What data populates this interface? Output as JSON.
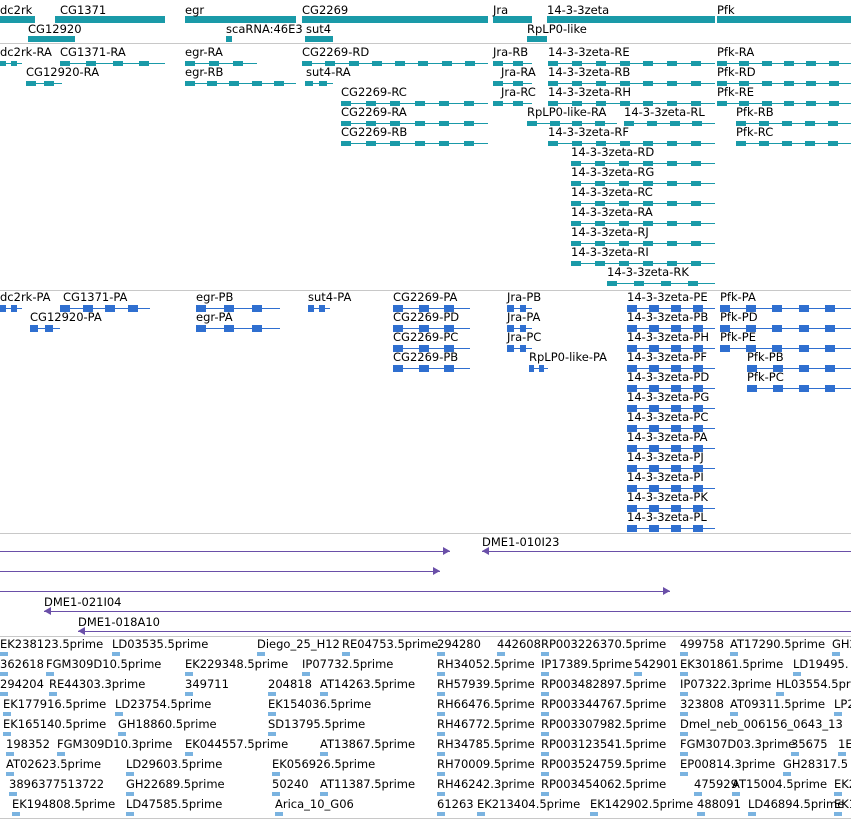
{
  "colors": {
    "gene": "#1a9aa8",
    "transcript": "#1a9aa8",
    "protein": "#2f6fd0",
    "clone": "#6a4fa8",
    "est": "#7ab3e0",
    "separator": "#c8c8c8"
  },
  "genes": [
    {
      "label": "dc2rk"
    },
    {
      "label": "CG1371"
    },
    {
      "label": "CG12920"
    },
    {
      "label": "egr"
    },
    {
      "label": "scaRNA:46E3"
    },
    {
      "label": "CG2269"
    },
    {
      "label": "sut4"
    },
    {
      "label": "Jra"
    },
    {
      "label": "14-3-3zeta"
    },
    {
      "label": "RpLP0-like"
    },
    {
      "label": "Pfk"
    }
  ],
  "transcripts": [
    {
      "label": "dc2rk-RA"
    },
    {
      "label": "CG1371-RA"
    },
    {
      "label": "CG12920-RA"
    },
    {
      "label": "egr-RA"
    },
    {
      "label": "egr-RB"
    },
    {
      "label": "CG2269-RD"
    },
    {
      "label": "sut4-RA"
    },
    {
      "label": "CG2269-RC"
    },
    {
      "label": "CG2269-RA"
    },
    {
      "label": "CG2269-RB"
    },
    {
      "label": "Jra-RB"
    },
    {
      "label": "Jra-RA"
    },
    {
      "label": "Jra-RC"
    },
    {
      "label": "RpLP0-like-RA"
    },
    {
      "label": "14-3-3zeta-RE"
    },
    {
      "label": "14-3-3zeta-RB"
    },
    {
      "label": "14-3-3zeta-RH"
    },
    {
      "label": "14-3-3zeta-RL"
    },
    {
      "label": "14-3-3zeta-RF"
    },
    {
      "label": "14-3-3zeta-RD"
    },
    {
      "label": "14-3-3zeta-RG"
    },
    {
      "label": "14-3-3zeta-RC"
    },
    {
      "label": "14-3-3zeta-RA"
    },
    {
      "label": "14-3-3zeta-RJ"
    },
    {
      "label": "14-3-3zeta-RI"
    },
    {
      "label": "14-3-3zeta-RK"
    },
    {
      "label": "Pfk-RA"
    },
    {
      "label": "Pfk-RD"
    },
    {
      "label": "Pfk-RE"
    },
    {
      "label": "Pfk-RB"
    },
    {
      "label": "Pfk-RC"
    }
  ],
  "proteins": [
    {
      "label": "dc2rk-PA"
    },
    {
      "label": "CG1371-PA"
    },
    {
      "label": "CG12920-PA"
    },
    {
      "label": "egr-PB"
    },
    {
      "label": "egr-PA"
    },
    {
      "label": "sut4-PA"
    },
    {
      "label": "CG2269-PA"
    },
    {
      "label": "CG2269-PD"
    },
    {
      "label": "CG2269-PC"
    },
    {
      "label": "CG2269-PB"
    },
    {
      "label": "Jra-PB"
    },
    {
      "label": "Jra-PA"
    },
    {
      "label": "Jra-PC"
    },
    {
      "label": "RpLP0-like-PA"
    },
    {
      "label": "14-3-3zeta-PE"
    },
    {
      "label": "14-3-3zeta-PB"
    },
    {
      "label": "14-3-3zeta-PH"
    },
    {
      "label": "14-3-3zeta-PF"
    },
    {
      "label": "14-3-3zeta-PD"
    },
    {
      "label": "14-3-3zeta-PG"
    },
    {
      "label": "14-3-3zeta-PC"
    },
    {
      "label": "14-3-3zeta-PA"
    },
    {
      "label": "14-3-3zeta-PJ"
    },
    {
      "label": "14-3-3zeta-PI"
    },
    {
      "label": "14-3-3zeta-PK"
    },
    {
      "label": "14-3-3zeta-PL"
    },
    {
      "label": "Pfk-PA"
    },
    {
      "label": "Pfk-PD"
    },
    {
      "label": "Pfk-PE"
    },
    {
      "label": "Pfk-PB"
    },
    {
      "label": "Pfk-PC"
    }
  ],
  "clones": [
    {
      "label": "DME1-010I23"
    },
    {
      "label": "DME1-021I04"
    },
    {
      "label": "DME1-018A10"
    }
  ],
  "ests": [
    {
      "label": "EK238123.5prime"
    },
    {
      "label": "LD03535.5prime"
    },
    {
      "label": "Diego_25_H12"
    },
    {
      "label": "RE04753.5prime"
    },
    {
      "label": "294280"
    },
    {
      "label": "442608"
    },
    {
      "label": "RP003226370.5prime"
    },
    {
      "label": "499758"
    },
    {
      "label": "AT17290.5prime"
    },
    {
      "label": "GH2"
    },
    {
      "label": "362618"
    },
    {
      "label": "FGM309D10.5prime"
    },
    {
      "label": "EK229348.5prime"
    },
    {
      "label": "IP07732.5prime"
    },
    {
      "label": "RH34052.5prime"
    },
    {
      "label": "IP17389.5prime"
    },
    {
      "label": "542901"
    },
    {
      "label": "EK301861.5prime"
    },
    {
      "label": "LD19495."
    },
    {
      "label": "294204"
    },
    {
      "label": "RE44303.3prime"
    },
    {
      "label": "349711"
    },
    {
      "label": "204818"
    },
    {
      "label": "AT14263.5prime"
    },
    {
      "label": "RH57939.5prime"
    },
    {
      "label": "RP003482897.5prime"
    },
    {
      "label": "IP07322.3prime"
    },
    {
      "label": "HL03554.5prime"
    },
    {
      "label": "EK177916.5prime"
    },
    {
      "label": "LD23754.5prime"
    },
    {
      "label": "EK154036.5prime"
    },
    {
      "label": "RH66476.5prime"
    },
    {
      "label": "RP003344767.5prime"
    },
    {
      "label": "323808"
    },
    {
      "label": "AT09311.5prime"
    },
    {
      "label": "LP2"
    },
    {
      "label": "EK165140.5prime"
    },
    {
      "label": "GH18860.5prime"
    },
    {
      "label": "SD13795.5prime"
    },
    {
      "label": "RH46772.5prime"
    },
    {
      "label": "RP003307982.5prime"
    },
    {
      "label": "Dmel_neb_006156_0643_13"
    },
    {
      "label": "198352"
    },
    {
      "label": "FGM309D10.3prime"
    },
    {
      "label": "EK044557.5prime"
    },
    {
      "label": "AT13867.5prime"
    },
    {
      "label": "RH34785.5prime"
    },
    {
      "label": "RP003123541.5prime"
    },
    {
      "label": "FGM307D03.3prime"
    },
    {
      "label": "35675"
    },
    {
      "label": "1E"
    },
    {
      "label": "AT02623.5prime"
    },
    {
      "label": "LD29603.5prime"
    },
    {
      "label": "EK056926.5prime"
    },
    {
      "label": "RH70009.5prime"
    },
    {
      "label": "RP003524759.5prime"
    },
    {
      "label": "EP00814.3prime"
    },
    {
      "label": "GH28317.5"
    },
    {
      "label": "3896377513722"
    },
    {
      "label": "GH22689.5prime"
    },
    {
      "label": "50240"
    },
    {
      "label": "AT11387.5prime"
    },
    {
      "label": "RH46242.3prime"
    },
    {
      "label": "RP003454062.5prime"
    },
    {
      "label": "475929"
    },
    {
      "label": "AT15004.5prime"
    },
    {
      "label": "EK2"
    },
    {
      "label": "EK194808.5prime"
    },
    {
      "label": "LD47585.5prime"
    },
    {
      "label": "Arica_10_G06"
    },
    {
      "label": "61263"
    },
    {
      "label": "EK213404.5prime"
    },
    {
      "label": "EK142902.5prime"
    },
    {
      "label": "488091"
    },
    {
      "label": "LD46894.5prime"
    },
    {
      "label": "EK1"
    }
  ]
}
